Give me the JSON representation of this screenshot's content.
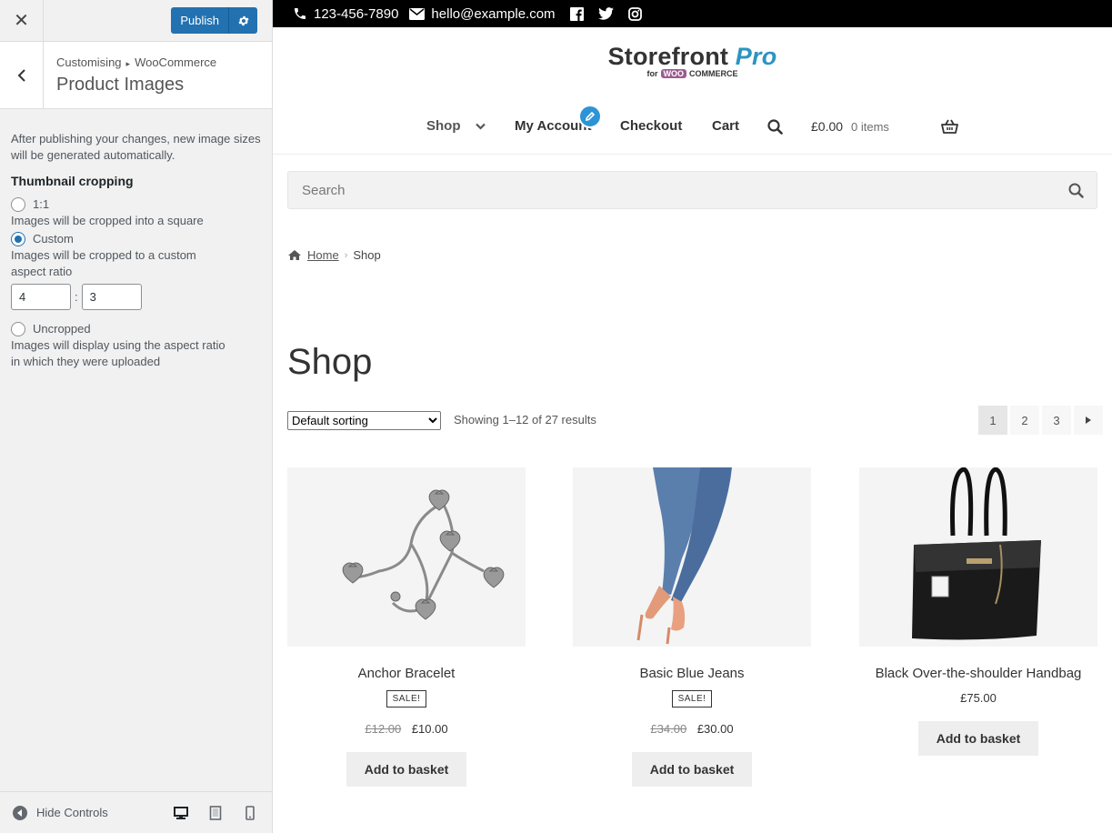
{
  "customizer": {
    "close_icon": "close-icon",
    "publish_label": "Publish",
    "publish_settings_icon": "gear-icon",
    "breadcrumb_root": "Customising",
    "breadcrumb_sep": "▸",
    "breadcrumb_parent": "WooCommerce",
    "section_title": "Product Images",
    "description": "After publishing your changes, new image sizes will be generated automatically.",
    "cropping_title": "Thumbnail cropping",
    "options": [
      {
        "label": "1:1",
        "description": "Images will be cropped into a square",
        "selected": false
      },
      {
        "label": "Custom",
        "description": "Images will be cropped to a custom aspect ratio",
        "selected": true
      },
      {
        "label": "Uncropped",
        "description": "Images will display using the aspect ratio in which they were uploaded",
        "selected": false
      }
    ],
    "ratio_width": "4",
    "ratio_sep": ":",
    "ratio_height": "3",
    "hide_controls_label": "Hide Controls",
    "accent_color": "#2271b1"
  },
  "topbar": {
    "phone": "123-456-7890",
    "email": "hello@example.com",
    "social_icons": [
      "facebook-icon",
      "twitter-icon",
      "instagram-icon"
    ]
  },
  "logo": {
    "name": "Storefront",
    "pro": "Pro",
    "for": "for",
    "woo": "WOO",
    "commerce": "COMMERCE"
  },
  "nav": {
    "shop": "Shop",
    "my_account": "My Account",
    "checkout": "Checkout",
    "cart": "Cart",
    "cart_total": "£0.00",
    "cart_items": "0 items"
  },
  "search": {
    "placeholder": "Search"
  },
  "breadcrumb": {
    "home": "Home",
    "current": "Shop"
  },
  "page_title": "Shop",
  "sorting": {
    "selected": "Default sorting",
    "options": [
      "Default sorting"
    ]
  },
  "result_count": "Showing 1–12 of 27 results",
  "pagination": [
    "1",
    "2",
    "3"
  ],
  "products": [
    {
      "name": "Anchor Bracelet",
      "badge": "SALE!",
      "old_price": "£12.00",
      "price": "£10.00",
      "button": "Add to basket"
    },
    {
      "name": "Basic Blue Jeans",
      "badge": "SALE!",
      "old_price": "£34.00",
      "price": "£30.00",
      "button": "Add to basket"
    },
    {
      "name": "Black Over-the-shoulder Handbag",
      "price": "£75.00",
      "button": "Add to basket"
    }
  ]
}
